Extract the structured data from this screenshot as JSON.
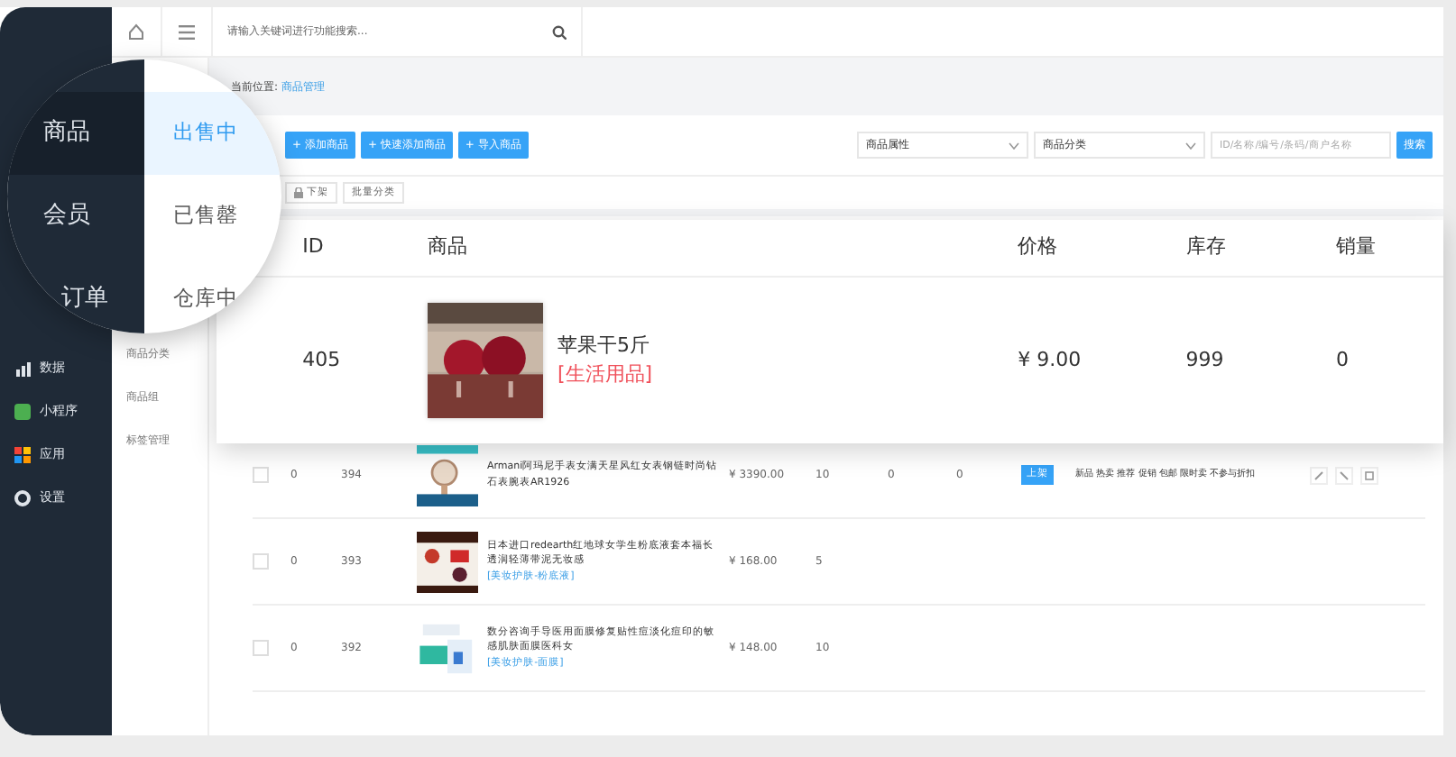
{
  "topbar": {
    "search_placeholder": "请输入关键词进行功能搜索..."
  },
  "magnifier": {
    "menu": [
      {
        "label": "商品",
        "selected": true
      },
      {
        "label": "会员",
        "selected": false
      },
      {
        "label": "订单",
        "selected": false
      }
    ],
    "submenu": [
      {
        "label": "出售中",
        "selected": true
      },
      {
        "label": "已售罄",
        "selected": false
      },
      {
        "label": "仓库中",
        "selected": false
      }
    ]
  },
  "sidebar": {
    "items": [
      {
        "label": "数据",
        "kind": "chart"
      },
      {
        "label": "小程序",
        "kind": "mini"
      },
      {
        "label": "应用",
        "kind": "apps"
      },
      {
        "label": "设置",
        "kind": "gear"
      }
    ]
  },
  "subnav": {
    "items": [
      "商品分类",
      "商品组",
      "标签管理"
    ]
  },
  "breadcrumb": {
    "label": "当前位置:",
    "current": "商品管理"
  },
  "toolbar": {
    "buttons": [
      "+ 添加商品",
      "+ 快速添加商品",
      "+ 导入商品"
    ],
    "filters": [
      {
        "kind": "select",
        "value": "商品属性"
      },
      {
        "kind": "select",
        "value": "商品分类"
      },
      {
        "kind": "input",
        "placeholder": "ID/名称/编号/条码/商户名称"
      }
    ],
    "search_button": "搜索"
  },
  "bulk_actions": [
    "下架",
    "批量分类"
  ],
  "featured_row": {
    "columns": [
      "ID",
      "商品",
      "价格",
      "库存",
      "销量"
    ],
    "id": "405",
    "name": "苹果干5斤",
    "category": "[生活用品]",
    "price": "¥ 9.00",
    "stock": "999",
    "sales": "0"
  },
  "rows": [
    {
      "checked": false,
      "sort": "0",
      "id": "394",
      "title": "Armani阿玛尼手表女满天星风红女表钢链时尚钻石表腕表AR1926",
      "price": "¥ 3390.00",
      "stock": "10",
      "col_a": "0",
      "col_b": "0",
      "status": "上架",
      "tags": "新品 热卖 推荐 促销 包邮 限时卖 不参与折扣"
    },
    {
      "checked": false,
      "sort": "0",
      "id": "393",
      "title": "日本进口redearth红地球女学生粉底液套本福长透润轻薄带泥无妆感",
      "category": "[美妆护肤-粉底液]",
      "price": "¥ 168.00",
      "stock": "5"
    },
    {
      "checked": false,
      "sort": "0",
      "id": "392",
      "title": "数分咨询手导医用面膜修复贴性痘淡化痘印的敏感肌肤面膜医科女",
      "category": "[美妆护肤-面膜]",
      "price": "¥ 148.00",
      "stock": "10"
    }
  ]
}
